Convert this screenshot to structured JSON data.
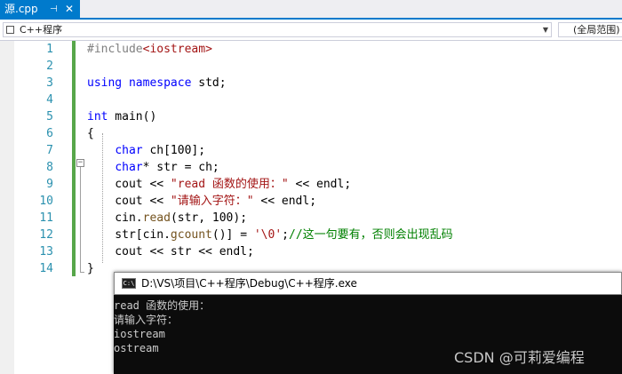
{
  "tab": {
    "title": "源.cpp",
    "pin": "⊣",
    "close": "✕"
  },
  "navbar": {
    "project": "C++程序",
    "scope": "(全局范围)"
  },
  "editor": {
    "lines": [
      {
        "num": "1",
        "code": [
          {
            "t": "#include",
            "c": "pp"
          },
          {
            "t": "<iostream>",
            "c": "inc"
          }
        ]
      },
      {
        "num": "2",
        "code": []
      },
      {
        "num": "3",
        "code": [
          {
            "t": "using",
            "c": "kw"
          },
          {
            "t": " ",
            "c": ""
          },
          {
            "t": "namespace",
            "c": "kw"
          },
          {
            "t": " std;",
            "c": ""
          }
        ]
      },
      {
        "num": "4",
        "code": []
      },
      {
        "num": "5",
        "code": [
          {
            "t": "int",
            "c": "kw"
          },
          {
            "t": " main()",
            "c": ""
          }
        ]
      },
      {
        "num": "6",
        "code": [
          {
            "t": "{",
            "c": ""
          }
        ]
      },
      {
        "num": "7",
        "code": [
          {
            "t": "    ",
            "c": ""
          },
          {
            "t": "char",
            "c": "kw"
          },
          {
            "t": " ch[100];",
            "c": ""
          }
        ]
      },
      {
        "num": "8",
        "code": [
          {
            "t": "    ",
            "c": ""
          },
          {
            "t": "char",
            "c": "kw"
          },
          {
            "t": "* str = ch;",
            "c": ""
          }
        ]
      },
      {
        "num": "9",
        "code": [
          {
            "t": "    cout << ",
            "c": ""
          },
          {
            "t": "\"read 函数的使用：\"",
            "c": "str"
          },
          {
            "t": " << endl;",
            "c": ""
          }
        ]
      },
      {
        "num": "10",
        "code": [
          {
            "t": "    cout << ",
            "c": ""
          },
          {
            "t": "\"请输入字符：\"",
            "c": "str"
          },
          {
            "t": " << endl;",
            "c": ""
          }
        ]
      },
      {
        "num": "11",
        "code": [
          {
            "t": "    cin.",
            "c": ""
          },
          {
            "t": "read",
            "c": "fn"
          },
          {
            "t": "(str, 100);",
            "c": ""
          }
        ]
      },
      {
        "num": "12",
        "code": [
          {
            "t": "    str[cin.",
            "c": ""
          },
          {
            "t": "gcount",
            "c": "fn"
          },
          {
            "t": "()] = ",
            "c": ""
          },
          {
            "t": "'\\0'",
            "c": "str"
          },
          {
            "t": ";",
            "c": ""
          },
          {
            "t": "//这一句要有，否则会出现乱码",
            "c": "cm"
          }
        ]
      },
      {
        "num": "13",
        "code": [
          {
            "t": "    cout << str << endl;",
            "c": ""
          }
        ]
      },
      {
        "num": "14",
        "code": [
          {
            "t": "}",
            "c": ""
          }
        ]
      }
    ]
  },
  "console": {
    "icon": "C:\\",
    "title": "D:\\VS\\项目\\C++程序\\Debug\\C++程序.exe",
    "output": [
      "read 函数的使用：",
      "请输入字符：",
      "iostream",
      "ostream"
    ]
  },
  "watermark": "CSDN @可莉爱编程",
  "colors": {
    "accent": "#007acc",
    "keyword": "#0000ff",
    "string": "#a31515",
    "comment": "#008000",
    "line_number": "#2b91af",
    "change_bar": "#57a64a"
  }
}
